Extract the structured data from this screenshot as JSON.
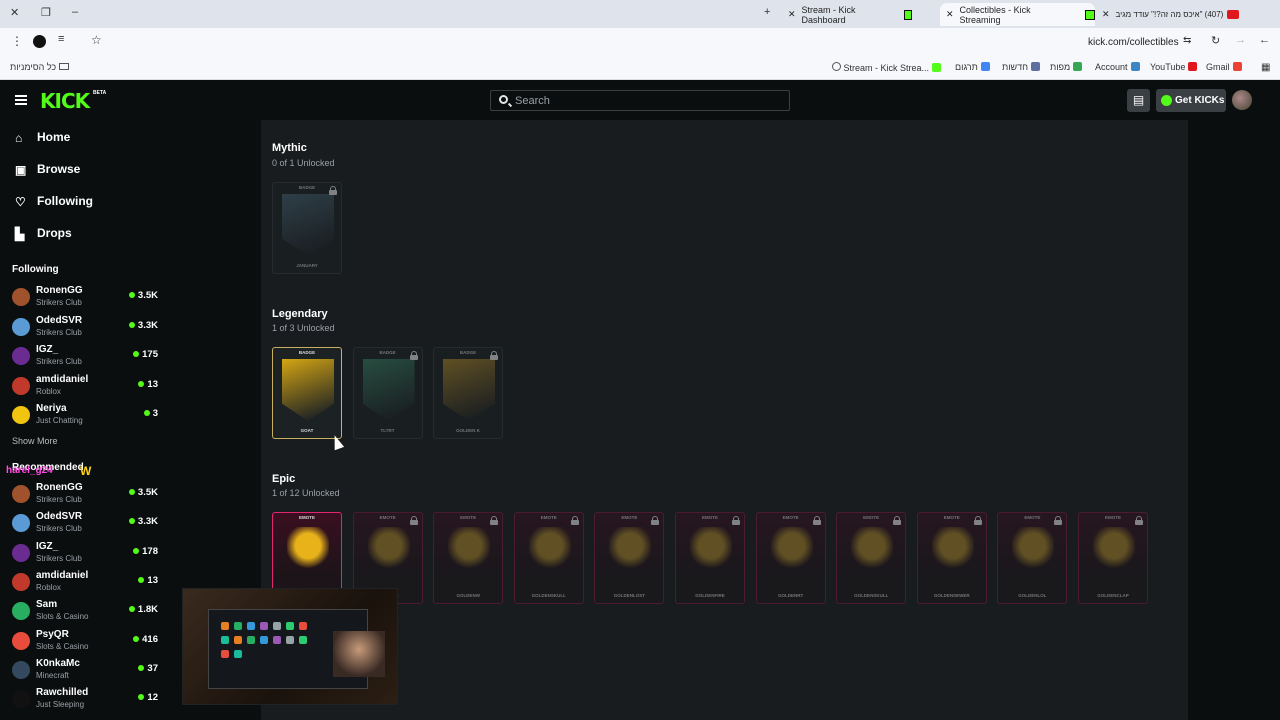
{
  "browser": {
    "tabs": [
      {
        "title": "Stream - Kick Dashboard",
        "active": false
      },
      {
        "title": "Collectibles - Kick Streaming",
        "active": true
      },
      {
        "title": "(407) \"איכס מה זה?!\" עודד מגיב",
        "active": false
      }
    ],
    "url": "kick.com/collectibles",
    "bookmarks_folder": "כל הסימניות",
    "bookmarks": [
      "Stream - Kick Strea...",
      "תרגום",
      "חדשות",
      "מפות",
      "Account",
      "YouTube",
      "Gmail"
    ]
  },
  "kick": {
    "logo": "KICK",
    "beta": "BETA",
    "search_placeholder": "Search",
    "get_kicks": "Get KICKs"
  },
  "sidebar": {
    "nav": [
      {
        "label": "Home",
        "icon": "home-icon"
      },
      {
        "label": "Browse",
        "icon": "browse-icon"
      },
      {
        "label": "Following",
        "icon": "heart-icon"
      },
      {
        "label": "Drops",
        "icon": "drops-icon"
      }
    ],
    "following_title": "Following",
    "following": [
      {
        "name": "RonenGG",
        "category": "Strikers Club",
        "viewers": "3.5K",
        "color": "#a0522d"
      },
      {
        "name": "OdedSVR",
        "category": "Strikers Club",
        "viewers": "3.3K",
        "color": "#5b9bd5"
      },
      {
        "name": "IGZ_",
        "category": "Strikers Club",
        "viewers": "175",
        "color": "#6a2c91"
      },
      {
        "name": "amdidaniel",
        "category": "Roblox",
        "viewers": "13",
        "color": "#c0392b"
      },
      {
        "name": "Neriya",
        "category": "Just Chatting",
        "viewers": "3",
        "color": "#f1c40f"
      }
    ],
    "show_more": "Show More",
    "recommended_title": "Recommended",
    "overlay_name": "harel_g24",
    "overlay_w": "W",
    "recommended": [
      {
        "name": "RonenGG",
        "category": "Strikers Club",
        "viewers": "3.5K",
        "color": "#a0522d"
      },
      {
        "name": "OdedSVR",
        "category": "Strikers Club",
        "viewers": "3.3K",
        "color": "#5b9bd5"
      },
      {
        "name": "IGZ_",
        "category": "Strikers Club",
        "viewers": "178",
        "color": "#6a2c91"
      },
      {
        "name": "amdidaniel",
        "category": "Roblox",
        "viewers": "13",
        "color": "#c0392b"
      },
      {
        "name": "Sam",
        "category": "Slots & Casino",
        "viewers": "1.8K",
        "color": "#27ae60"
      },
      {
        "name": "PsyQR",
        "category": "Slots & Casino",
        "viewers": "416",
        "color": "#e74c3c"
      },
      {
        "name": "K0nkaMc",
        "category": "Minecraft",
        "viewers": "37",
        "color": "#34495e"
      },
      {
        "name": "Rawchilled",
        "category": "Just Sleeping",
        "viewers": "12",
        "color": "#111111"
      }
    ]
  },
  "collectibles": {
    "mythic": {
      "title": "Mythic",
      "unlocked": "0 of 1 Unlocked",
      "cards": [
        {
          "type": "BADGE",
          "label": "JANUARY",
          "locked": true,
          "color": "#4a6a7a"
        }
      ]
    },
    "legendary": {
      "title": "Legendary",
      "unlocked": "1 of 3 Unlocked",
      "cards": [
        {
          "type": "BADGE",
          "label": "GOAT",
          "locked": false,
          "color": "#d4a514"
        },
        {
          "type": "BADGE",
          "label": "TLTRT",
          "locked": true,
          "color": "#3a8a6a"
        },
        {
          "type": "BADGE",
          "label": "GOLDEN K",
          "locked": true,
          "color": "#b8902a"
        }
      ]
    },
    "epic": {
      "title": "Epic",
      "unlocked": "1 of 12 Unlocked",
      "cards": [
        {
          "type": "EMOTE",
          "label": "",
          "locked": false,
          "color": "#e8b21a"
        },
        {
          "type": "EMOTE",
          "label": "GOLDENL",
          "locked": true,
          "color": "#b8902a"
        },
        {
          "type": "EMOTE",
          "label": "GOLDENW",
          "locked": true,
          "color": "#b8902a"
        },
        {
          "type": "EMOTE",
          "label": "GOLDENSKULL",
          "locked": true,
          "color": "#b8902a"
        },
        {
          "type": "EMOTE",
          "label": "GOLDENLOST",
          "locked": true,
          "color": "#b8902a"
        },
        {
          "type": "EMOTE",
          "label": "GOLDENFIRE",
          "locked": true,
          "color": "#b8902a"
        },
        {
          "type": "EMOTE",
          "label": "GOLDENRT",
          "locked": true,
          "color": "#b8902a"
        },
        {
          "type": "EMOTE",
          "label": "GOLDENSKULL",
          "locked": true,
          "color": "#b8902a"
        },
        {
          "type": "EMOTE",
          "label": "GOLDENSEWER",
          "locked": true,
          "color": "#b8902a"
        },
        {
          "type": "EMOTE",
          "label": "GOLDENLOL",
          "locked": true,
          "color": "#b8902a"
        },
        {
          "type": "EMOTE",
          "label": "GOLDENCLAP",
          "locked": true,
          "color": "#b8902a"
        }
      ]
    }
  },
  "colors": {
    "accent": "#53fc18",
    "background": "#0b0e0f",
    "panel": "#181c1f",
    "epic_border": "#e0266f"
  }
}
